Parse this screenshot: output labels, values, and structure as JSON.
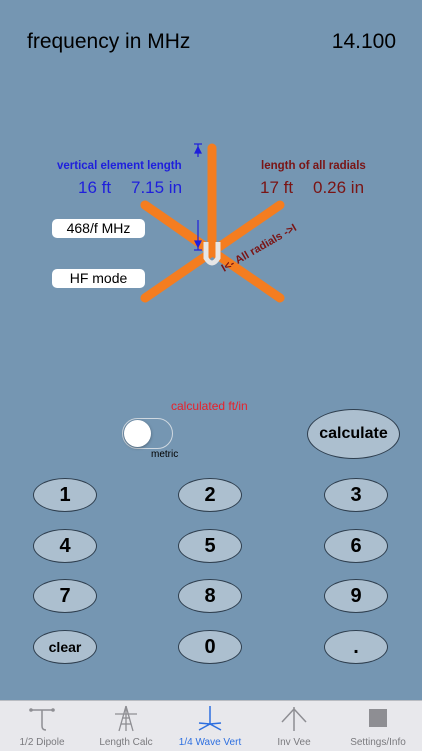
{
  "header": {
    "label": "frequency in MHz",
    "value": "14.100"
  },
  "vertical": {
    "label": "vertical element length",
    "ft": "16 ft",
    "in": "7.15 in"
  },
  "radials": {
    "label": "length of all radials",
    "ft": "17 ft",
    "in": "0.26 in",
    "diagram_label": "I<- All radials ->I"
  },
  "formula_button": "468/f MHz",
  "mode_button": "HF mode",
  "calculated_label": "calculated ft/in",
  "metric": {
    "label": "metric",
    "on": false
  },
  "calculate_button": "calculate",
  "keypad": [
    "1",
    "2",
    "3",
    "4",
    "5",
    "6",
    "7",
    "8",
    "9",
    "clear",
    "0",
    "."
  ],
  "tabs": [
    {
      "label": "1/2 Dipole",
      "icon": "dipole-icon",
      "active": false
    },
    {
      "label": "Length Calc",
      "icon": "tower-icon",
      "active": false
    },
    {
      "label": "1/4 Wave Vert",
      "icon": "vertical-antenna-icon",
      "active": true
    },
    {
      "label": "Inv Vee",
      "icon": "inverted-vee-icon",
      "active": false
    },
    {
      "label": "Settings/Info",
      "icon": "settings-square-icon",
      "active": false
    }
  ],
  "colors": {
    "background": "#7596b2",
    "vertical_text": "#1f1fdc",
    "radial_text": "#7a1414",
    "antenna": "#f47d20",
    "calculated_text": "#e8202a",
    "active_tab": "#2d6fe0"
  }
}
